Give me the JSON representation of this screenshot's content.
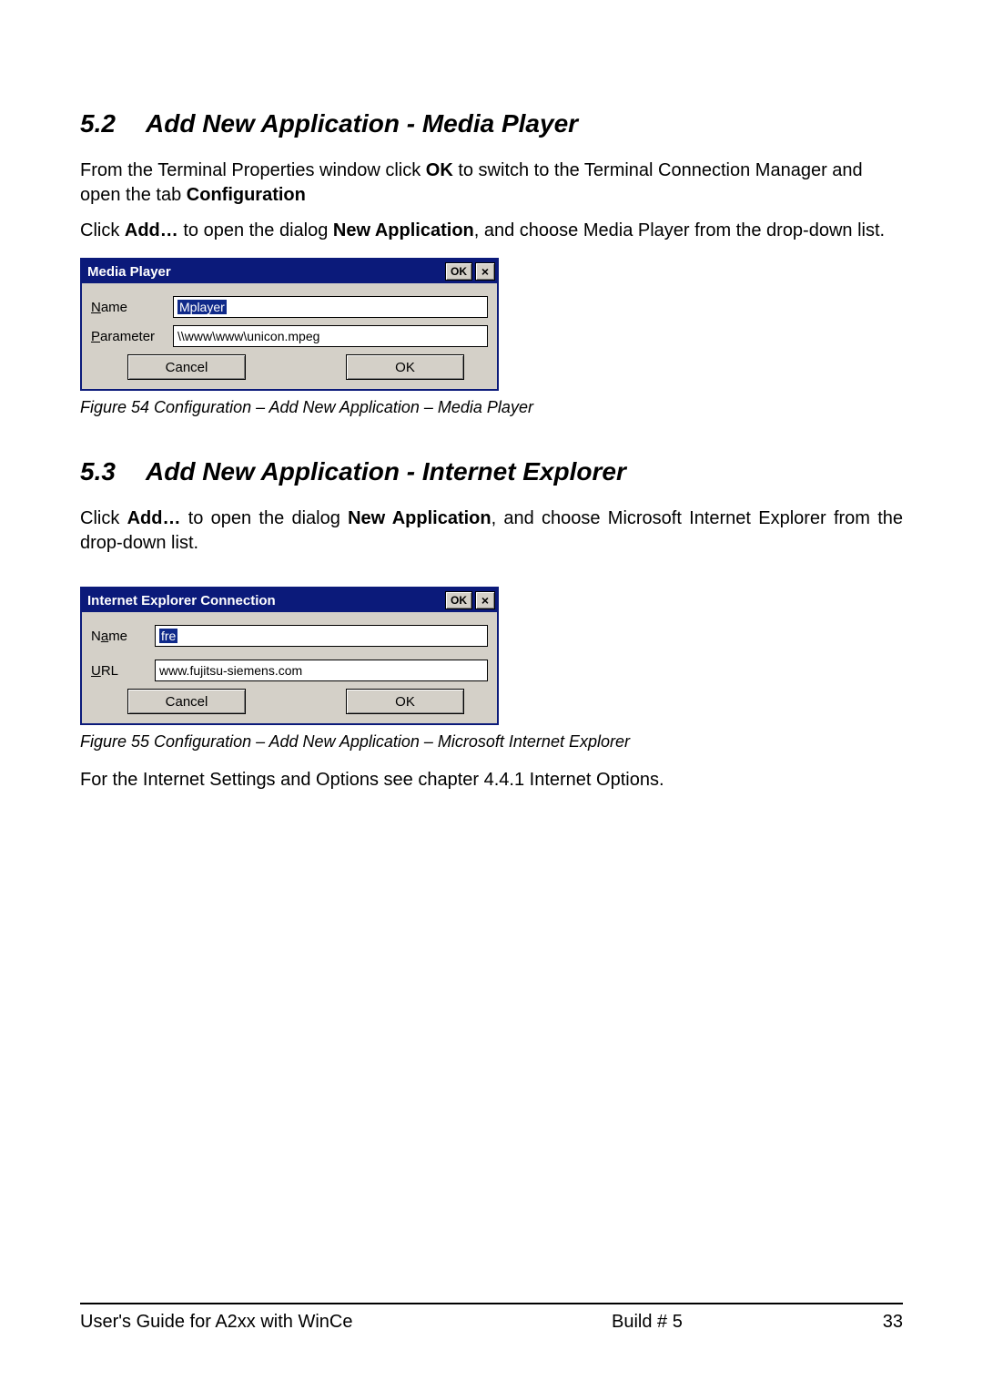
{
  "section52": {
    "number": "5.2",
    "title": "Add New Application - Media Player",
    "para1_a": "From the Terminal Properties window click ",
    "para1_b": "OK",
    "para1_c": " to switch to the Terminal Connection Manager and open the tab ",
    "para1_d": "Configuration",
    "para2_a": "Click ",
    "para2_b": "Add…",
    "para2_c": " to open the dialog ",
    "para2_d": "New Application",
    "para2_e": ", and choose Media Player from the drop-down list.",
    "caption": "Figure 54 Configuration – Add New Application – Media Player"
  },
  "dialog1": {
    "title": "Media Player",
    "ok_label": "OK",
    "close_label": "×",
    "name_label_pre": "N",
    "name_label_rest": "ame",
    "name_value": "Mplayer",
    "param_label_pre": "P",
    "param_label_rest": "arameter",
    "param_value": "\\\\www\\www\\unicon.mpeg",
    "cancel": "Cancel",
    "ok_btn": "OK"
  },
  "section53": {
    "number": "5.3",
    "title": "Add New Application - Internet Explorer",
    "para1_a": "Click ",
    "para1_b": "Add…",
    "para1_c": " to open the dialog ",
    "para1_d": "New Application",
    "para1_e": ", and choose Microsoft Internet Explorer from the drop-down list.",
    "caption": "Figure 55 Configuration – Add New Application – Microsoft Internet Explorer",
    "after": "For the Internet Settings and Options see chapter 4.4.1 Internet Options."
  },
  "dialog2": {
    "title": "Internet Explorer Connection",
    "ok_label": "OK",
    "close_label": "×",
    "name_label_pre": "a",
    "name_label_pre_char": "N",
    "name_label_rest": "me",
    "name_value": "fre",
    "url_label_pre": "U",
    "url_label_rest": "RL",
    "url_value": "www.fujitsu-siemens.com",
    "cancel": "Cancel",
    "ok_btn": "OK"
  },
  "footer": {
    "left": "User's Guide for A2xx with WinCe",
    "mid": "Build # 5",
    "right": "33"
  }
}
